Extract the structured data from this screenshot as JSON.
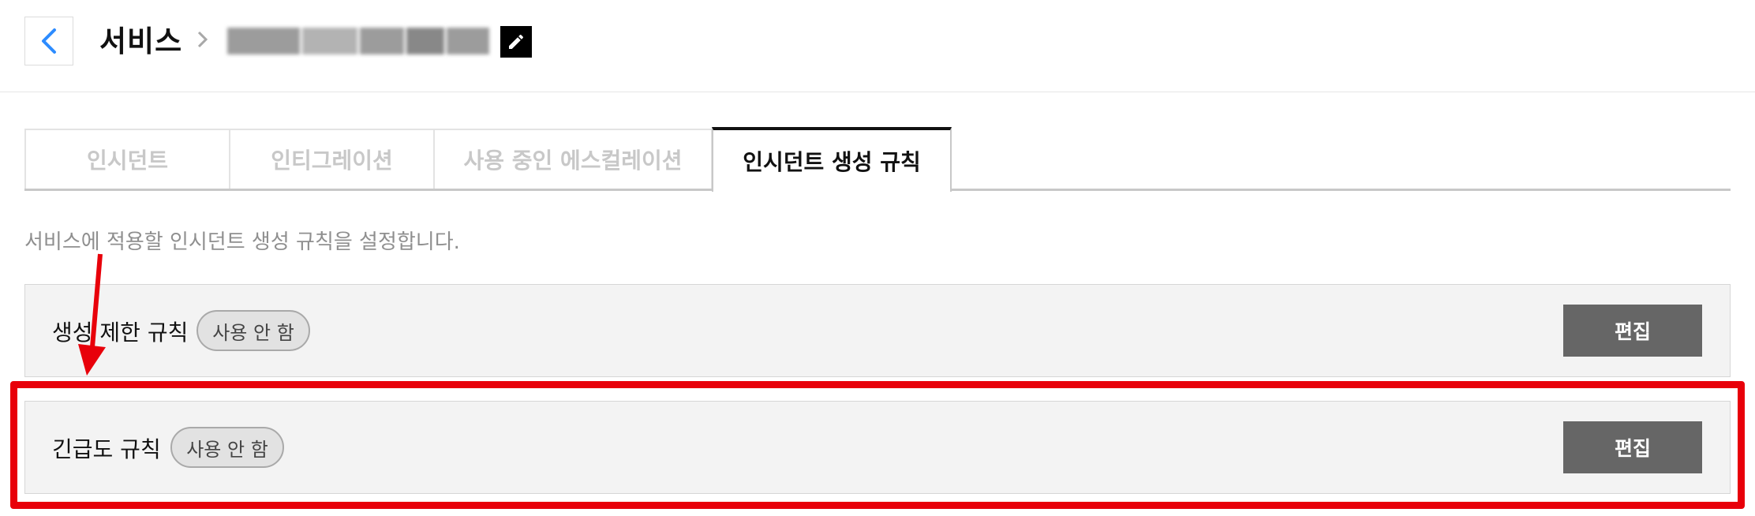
{
  "header": {
    "back_icon": "chevron-left-icon",
    "title": "서비스",
    "separator_icon": "chevron-right-icon",
    "service_name_redacted": true,
    "edit_icon": "pencil-icon",
    "accent_color": "#2d8cff"
  },
  "tabs": [
    {
      "label": "인시던트",
      "active": false
    },
    {
      "label": "인티그레이션",
      "active": false
    },
    {
      "label": "사용 중인 에스컬레이션",
      "active": false
    },
    {
      "label": "인시던트 생성 규칙",
      "active": true
    }
  ],
  "description": "서비스에 적용할 인시던트 생성 규칙을 설정합니다.",
  "rules": [
    {
      "name": "생성 제한 규칙",
      "status": "사용 안 함",
      "edit_label": "편집"
    },
    {
      "name": "긴급도 규칙",
      "status": "사용 안 함",
      "edit_label": "편집"
    }
  ],
  "annotation": {
    "color": "#e8000a",
    "arrow_icon": "red-arrow-down",
    "highlighted_rule": "긴급도 규칙"
  }
}
